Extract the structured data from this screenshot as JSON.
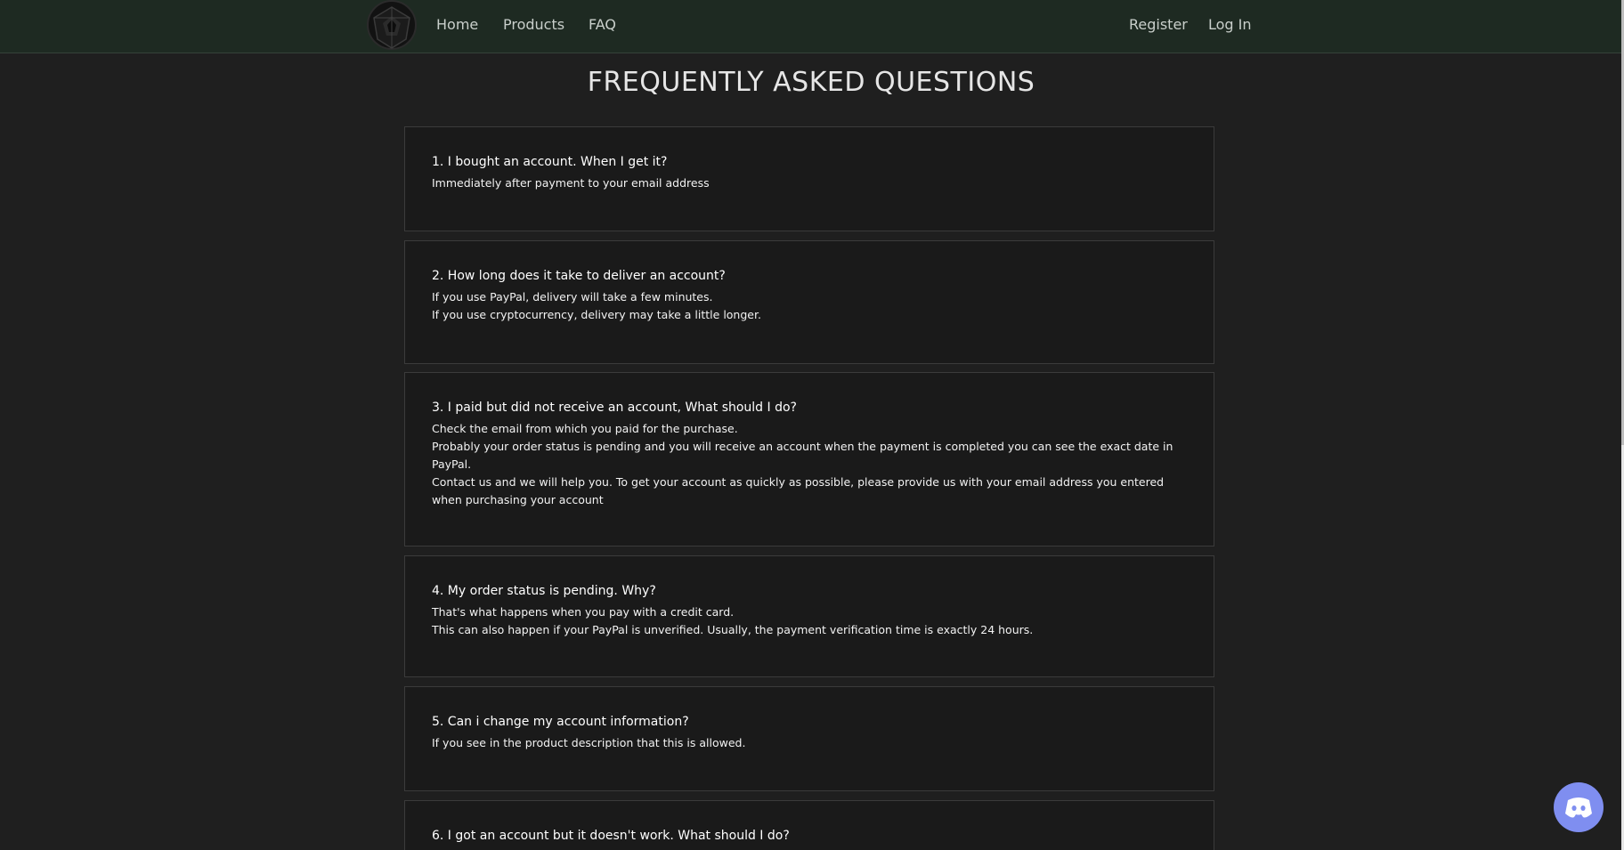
{
  "nav": {
    "home": "Home",
    "products": "Products",
    "faq": "FAQ",
    "register": "Register",
    "login": "Log In"
  },
  "page_title": "FREQUENTLY ASKED QUESTIONS",
  "faqs": [
    {
      "question": "1. I bought an account. When I get it?",
      "answers": [
        "Immediately after payment to your email address"
      ]
    },
    {
      "question": "2. How long does it take to deliver an account?",
      "answers": [
        "If you use PayPal, delivery will take a few minutes.",
        "If you use cryptocurrency, delivery may take a little longer."
      ]
    },
    {
      "question": "3. I paid but did not receive an account, What should I do?",
      "answers": [
        "Check the email from which you paid for the purchase.",
        "Probably your order status is pending and you will receive an account when the payment is completed you can see the exact date in PayPal.",
        "Contact us and we will help you. To get your account as quickly as possible, please provide us with your email address you entered when purchasing your account"
      ]
    },
    {
      "question": "4. My order status is pending. Why?",
      "answers": [
        "That's what happens when you pay with a credit card.",
        "This can also happen if your PayPal is unverified. Usually, the payment verification time is exactly 24 hours."
      ]
    },
    {
      "question": "5. Can i change my account information?",
      "answers": [
        "If you see in the product description that this is allowed."
      ]
    },
    {
      "question": "6. I got an account but it doesn't work. What should I do?",
      "answers": []
    }
  ],
  "colors": {
    "navbar_bg": "#1e2a22",
    "page_bg": "#1f1f1f",
    "card_bg": "#1a1a1a",
    "card_border": "#3b3b3b",
    "discord": "#7f8ef0"
  },
  "icons": {
    "logo": "shield-emblem-logo",
    "chat": "discord-icon"
  }
}
